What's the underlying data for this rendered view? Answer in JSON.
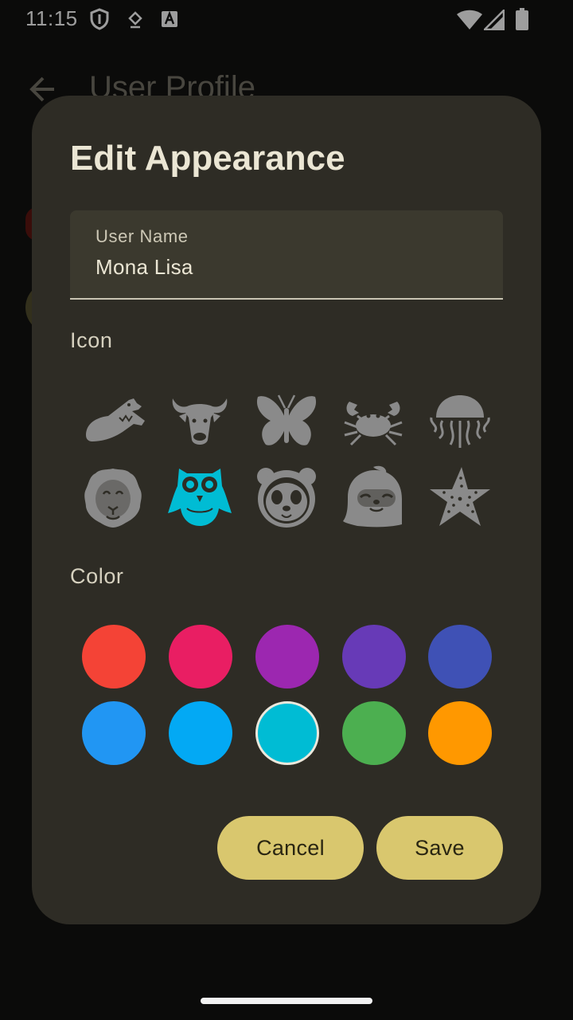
{
  "status_bar": {
    "time": "11:15",
    "icons": [
      "shield-icon",
      "download-icon",
      "a-box-icon",
      "wifi-icon",
      "signal-icon",
      "battery-icon"
    ]
  },
  "background": {
    "title": "User Profile",
    "icons": [
      "back-arrow-icon"
    ]
  },
  "dialog": {
    "title": "Edit Appearance",
    "user_name_label": "User Name",
    "user_name_value": "Mona Lisa",
    "icon_section_label": "Icon",
    "color_section_label": "Color",
    "icons": [
      {
        "name": "crocodile-icon",
        "selected": false
      },
      {
        "name": "bull-icon",
        "selected": false
      },
      {
        "name": "butterfly-icon",
        "selected": false
      },
      {
        "name": "crab-icon",
        "selected": false
      },
      {
        "name": "jellyfish-icon",
        "selected": false
      },
      {
        "name": "lion-icon",
        "selected": false
      },
      {
        "name": "owl-icon",
        "selected": true
      },
      {
        "name": "panda-icon",
        "selected": false
      },
      {
        "name": "sloth-icon",
        "selected": false
      },
      {
        "name": "starfish-icon",
        "selected": false
      }
    ],
    "colors": [
      {
        "hex": "#f44336",
        "selected": false
      },
      {
        "hex": "#e91e63",
        "selected": false
      },
      {
        "hex": "#9c27b0",
        "selected": false
      },
      {
        "hex": "#673ab7",
        "selected": false
      },
      {
        "hex": "#3f51b5",
        "selected": false
      },
      {
        "hex": "#2196f3",
        "selected": false
      },
      {
        "hex": "#03a9f4",
        "selected": false
      },
      {
        "hex": "#00bcd4",
        "selected": true
      },
      {
        "hex": "#4caf50",
        "selected": false
      },
      {
        "hex": "#ff9800",
        "selected": false
      }
    ],
    "icon_color": "#8a8a8a",
    "selected_icon_color": "#00bcd4",
    "cancel_label": "Cancel",
    "save_label": "Save"
  }
}
